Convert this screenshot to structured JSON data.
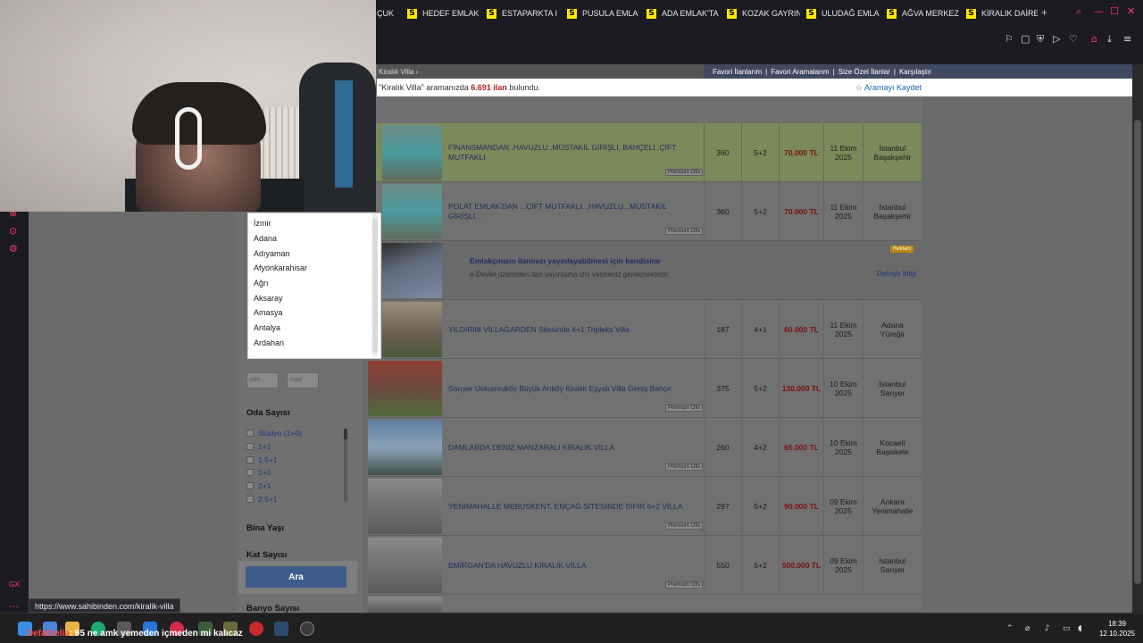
{
  "browser": {
    "tabs": [
      {
        "label": "ÇUK"
      },
      {
        "label": "HEDEF EMLAK"
      },
      {
        "label": "ESTAPARKTA I"
      },
      {
        "label": "PUSULA EMLA"
      },
      {
        "label": "ADA EMLAK'TA"
      },
      {
        "label": "KOZAK GAYRIN"
      },
      {
        "label": "ULUDAĞ EMLA"
      },
      {
        "label": "AĞVA MERKEZ"
      },
      {
        "label": "KİRALIK DAİRE"
      }
    ],
    "favicon_letter": "S",
    "new_tab": "+",
    "status_url": "https://www.sahibinden.com/kiralik-villa"
  },
  "page": {
    "breadcrumb": "Kiralık Villa ›",
    "nav_links": [
      "Favori İlanlarım",
      "|",
      "Favori Aramalarım",
      "|",
      "Size Özel İlanlar",
      "|",
      "Karşılaştır"
    ],
    "result_prefix": "\"Kiralık Villa\" aramanızda",
    "result_count": "6.691 ilan",
    "result_suffix": "bulundu.",
    "save_search": "Aramayı Kaydet",
    "premium_tag": "Premium Ofis"
  },
  "listings": [
    {
      "title": "FİNANSMANDAN..HAVUZLU..MÜSTAKİL GİRİŞLİ..BAHÇELİ..ÇİFT MUTFAKLI",
      "m2": "360",
      "rooms": "5+2",
      "price": "70.000 TL",
      "date_day": "11 Ekim",
      "date_year": "2025",
      "city": "İstanbul",
      "district": "Başakşehir"
    },
    {
      "title": "POLAT EMLAK'DAN ...ÇİFT MUTFAKLI...HAVUZLU...MÜSTAKİL GİRİŞLİ...",
      "m2": "360",
      "rooms": "5+2",
      "price": "70.000 TL",
      "date_day": "11 Ekim",
      "date_year": "2025",
      "city": "İstanbul",
      "district": "Başakşehir"
    },
    {
      "ad_title": "Emlakçınızın ilanınızı yayınlayabilmesi için kendisine",
      "ad_sub": "e-Devlet üzerinden ilan yayınlama izni vermeniz gerekmektedir.",
      "ad_link": "Detaylı bilgi",
      "ad_badge": "Reklam"
    },
    {
      "title": "YILDIRIM VİLLAGARDEN Sitesinde 4+1 Tripleks Villa",
      "m2": "187",
      "rooms": "4+1",
      "price": "60.000 TL",
      "date_day": "11 Ekim",
      "date_year": "2025",
      "city": "Adana",
      "district": "Yüreğir"
    },
    {
      "title": "Sarıyer Uskumruköy Büyük Arıköy Kiralık Eşyalı Villa Geniş Bahçe",
      "m2": "375",
      "rooms": "5+2",
      "price": "130.000 TL",
      "date_day": "10 Ekim",
      "date_year": "2025",
      "city": "İstanbul",
      "district": "Sarıyer"
    },
    {
      "title": "DAMLARDA DENİZ MANZARALI KİRALIK VİLLA",
      "m2": "260",
      "rooms": "4+2",
      "price": "65.000 TL",
      "date_day": "10 Ekim",
      "date_year": "2025",
      "city": "Kocaeli",
      "district": "Başiskele"
    },
    {
      "title": "YENİMAHALLE MEBUSKENT, ENÇAĞ SİTESİNDE SIFIR 6+2 VİLLA",
      "m2": "297",
      "rooms": "5+2",
      "price": "90.000 TL",
      "date_day": "09 Ekim",
      "date_year": "2025",
      "city": "Ankara",
      "district": "Yenimahalle"
    },
    {
      "title": "EMİRGAN'DA HAVUZLU KİRALIK VİLLA",
      "m2": "550",
      "rooms": "5+2",
      "price": "500.000 TL",
      "date_day": "09 Ekim",
      "date_year": "2025",
      "city": "İstanbul",
      "district": "Sarıyer"
    }
  ],
  "filters": {
    "min_placeholder": "min",
    "max_placeholder": "max",
    "dash": "-",
    "room_title": "Oda Sayısı",
    "room_options": [
      "Stüdyo (1+0)",
      "1+1",
      "1.5+1",
      "2+0",
      "2+1",
      "2.5+1"
    ],
    "building_age": "Bina Yaşı",
    "floor_count": "Kat Sayısı",
    "bathroom_count": "Banyo Sayısı",
    "search_button": "Ara"
  },
  "city_dropdown": [
    "İzmir",
    "Adana",
    "Adıyaman",
    "Afyonkarahisar",
    "Ağrı",
    "Aksaray",
    "Amasya",
    "Antalya",
    "Ardahan"
  ],
  "chat": {
    "user": "Defatbelia",
    "message": ": 95 ne amk yemeden içmeden mi kalıcaz"
  },
  "clock": {
    "time": "18:39",
    "date": "12.10.2025"
  }
}
